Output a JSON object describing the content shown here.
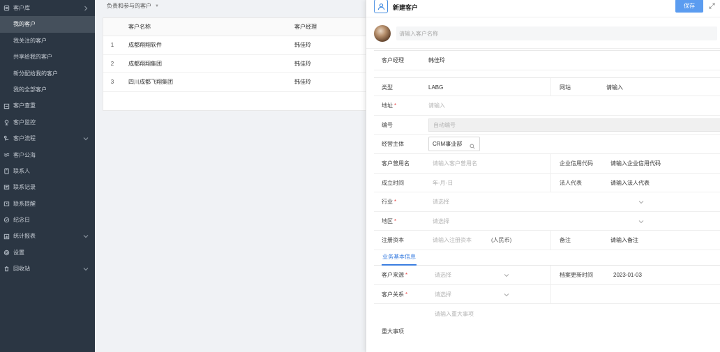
{
  "sidebar": {
    "items": [
      {
        "label": "客户库",
        "icon": "customer-library-icon",
        "has_chevron": true
      },
      {
        "label": "我的客户",
        "sub": true,
        "active": true
      },
      {
        "label": "我关注的客户",
        "sub": true
      },
      {
        "label": "共享给我的客户",
        "sub": true
      },
      {
        "label": "新分配给我的客户",
        "sub": true
      },
      {
        "label": "我的全部客户",
        "sub": true
      },
      {
        "label": "客户查重",
        "icon": "duplicate-check-icon"
      },
      {
        "label": "客户监控",
        "icon": "monitor-icon"
      },
      {
        "label": "客户流程",
        "icon": "workflow-icon",
        "has_chevron": true
      },
      {
        "label": "客户公海",
        "icon": "public-pool-icon"
      },
      {
        "label": "联系人",
        "icon": "contact-icon"
      },
      {
        "label": "联系记录",
        "icon": "record-icon"
      },
      {
        "label": "联系提醒",
        "icon": "reminder-icon"
      },
      {
        "label": "纪念日",
        "icon": "anniversary-icon"
      },
      {
        "label": "统计报表",
        "icon": "report-icon",
        "has_chevron": true
      },
      {
        "label": "设置",
        "icon": "settings-icon"
      },
      {
        "label": "回收站",
        "icon": "recycle-bin-icon",
        "has_chevron": true
      }
    ]
  },
  "main": {
    "filter_label": "负责和参与的客户",
    "table": {
      "headers": [
        "客户名称",
        "客户经理"
      ],
      "rows": [
        {
          "idx": "1",
          "name": "成都翔翔软件",
          "manager": "韩佳玲"
        },
        {
          "idx": "2",
          "name": "成都翔翔集团",
          "manager": "韩佳玲"
        },
        {
          "idx": "3",
          "name": "四川成都飞翔集团",
          "manager": "韩佳玲"
        }
      ]
    }
  },
  "panel": {
    "title": "新建客户",
    "save_label": "保存",
    "name_placeholder": "请输入客户名称",
    "manager_label": "客户经理",
    "manager_value": "韩佳玲",
    "form": {
      "type_label": "类型",
      "type_value": "LABG",
      "website_label": "网站",
      "website_placeholder": "请输入",
      "address_label": "地址",
      "address_placeholder": "请输入",
      "number_label": "编号",
      "number_placeholder": "自动编号",
      "org_label": "经营主体",
      "org_value": "CRM事业部",
      "alias_label": "客户曾用名",
      "alias_placeholder": "请输入客户曾用名",
      "credit_label": "企业信用代码",
      "credit_placeholder": "请输入企业信用代码",
      "founded_label": "成立时间",
      "founded_placeholder": "年-月-日",
      "legal_label": "法人代表",
      "legal_placeholder": "请输入法人代表",
      "industry_label": "行业",
      "industry_placeholder": "请选择",
      "region_label": "地区",
      "region_placeholder": "请选择",
      "capital_label": "注册资本",
      "capital_placeholder": "请输入注册资本",
      "capital_unit": "(人民币)",
      "remark_label": "备注",
      "remark_placeholder": "请输入备注"
    },
    "section_tab": "业务基本信息",
    "business": {
      "source_label": "客户来源",
      "source_placeholder": "请选择",
      "archive_label": "档案更新时间",
      "archive_value": "2023-01-03",
      "relation_label": "客户关系",
      "relation_placeholder": "请选择",
      "events_label": "重大事项",
      "events_placeholder": "请输入重大事项"
    }
  }
}
